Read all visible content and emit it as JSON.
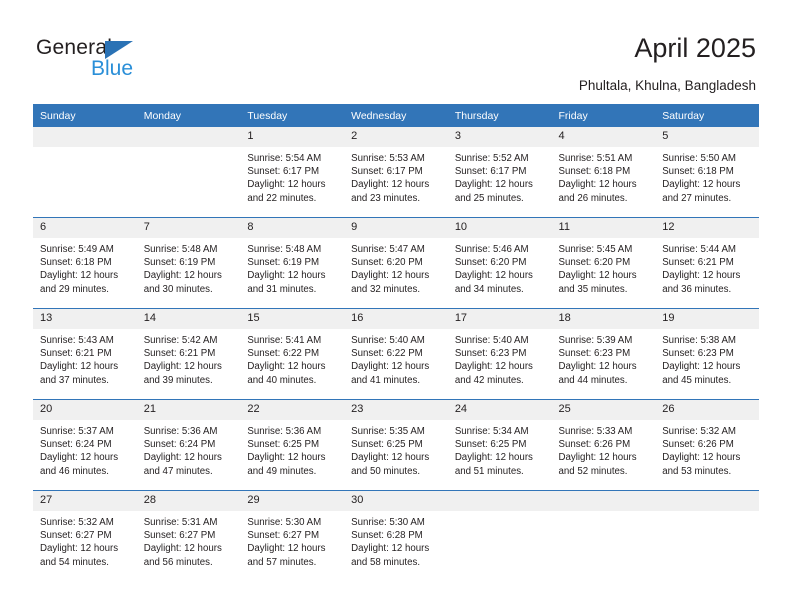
{
  "brand": {
    "name_part1": "General",
    "name_part2": "Blue",
    "flag_color": "#2a72b5",
    "blue_text_color": "#2a8fd8"
  },
  "header": {
    "title": "April 2025",
    "subtitle": "Phultala, Khulna, Bangladesh"
  },
  "calendar": {
    "header_color": "#3275b8",
    "daynum_band_color": "#f0f0f0",
    "weekday_headers": [
      "Sunday",
      "Monday",
      "Tuesday",
      "Wednesday",
      "Thursday",
      "Friday",
      "Saturday"
    ],
    "weeks": [
      [
        {
          "day": "",
          "lines": []
        },
        {
          "day": "",
          "lines": []
        },
        {
          "day": "1",
          "lines": [
            "Sunrise: 5:54 AM",
            "Sunset: 6:17 PM",
            "Daylight: 12 hours",
            "and 22 minutes."
          ]
        },
        {
          "day": "2",
          "lines": [
            "Sunrise: 5:53 AM",
            "Sunset: 6:17 PM",
            "Daylight: 12 hours",
            "and 23 minutes."
          ]
        },
        {
          "day": "3",
          "lines": [
            "Sunrise: 5:52 AM",
            "Sunset: 6:17 PM",
            "Daylight: 12 hours",
            "and 25 minutes."
          ]
        },
        {
          "day": "4",
          "lines": [
            "Sunrise: 5:51 AM",
            "Sunset: 6:18 PM",
            "Daylight: 12 hours",
            "and 26 minutes."
          ]
        },
        {
          "day": "5",
          "lines": [
            "Sunrise: 5:50 AM",
            "Sunset: 6:18 PM",
            "Daylight: 12 hours",
            "and 27 minutes."
          ]
        }
      ],
      [
        {
          "day": "6",
          "lines": [
            "Sunrise: 5:49 AM",
            "Sunset: 6:18 PM",
            "Daylight: 12 hours",
            "and 29 minutes."
          ]
        },
        {
          "day": "7",
          "lines": [
            "Sunrise: 5:48 AM",
            "Sunset: 6:19 PM",
            "Daylight: 12 hours",
            "and 30 minutes."
          ]
        },
        {
          "day": "8",
          "lines": [
            "Sunrise: 5:48 AM",
            "Sunset: 6:19 PM",
            "Daylight: 12 hours",
            "and 31 minutes."
          ]
        },
        {
          "day": "9",
          "lines": [
            "Sunrise: 5:47 AM",
            "Sunset: 6:20 PM",
            "Daylight: 12 hours",
            "and 32 minutes."
          ]
        },
        {
          "day": "10",
          "lines": [
            "Sunrise: 5:46 AM",
            "Sunset: 6:20 PM",
            "Daylight: 12 hours",
            "and 34 minutes."
          ]
        },
        {
          "day": "11",
          "lines": [
            "Sunrise: 5:45 AM",
            "Sunset: 6:20 PM",
            "Daylight: 12 hours",
            "and 35 minutes."
          ]
        },
        {
          "day": "12",
          "lines": [
            "Sunrise: 5:44 AM",
            "Sunset: 6:21 PM",
            "Daylight: 12 hours",
            "and 36 minutes."
          ]
        }
      ],
      [
        {
          "day": "13",
          "lines": [
            "Sunrise: 5:43 AM",
            "Sunset: 6:21 PM",
            "Daylight: 12 hours",
            "and 37 minutes."
          ]
        },
        {
          "day": "14",
          "lines": [
            "Sunrise: 5:42 AM",
            "Sunset: 6:21 PM",
            "Daylight: 12 hours",
            "and 39 minutes."
          ]
        },
        {
          "day": "15",
          "lines": [
            "Sunrise: 5:41 AM",
            "Sunset: 6:22 PM",
            "Daylight: 12 hours",
            "and 40 minutes."
          ]
        },
        {
          "day": "16",
          "lines": [
            "Sunrise: 5:40 AM",
            "Sunset: 6:22 PM",
            "Daylight: 12 hours",
            "and 41 minutes."
          ]
        },
        {
          "day": "17",
          "lines": [
            "Sunrise: 5:40 AM",
            "Sunset: 6:23 PM",
            "Daylight: 12 hours",
            "and 42 minutes."
          ]
        },
        {
          "day": "18",
          "lines": [
            "Sunrise: 5:39 AM",
            "Sunset: 6:23 PM",
            "Daylight: 12 hours",
            "and 44 minutes."
          ]
        },
        {
          "day": "19",
          "lines": [
            "Sunrise: 5:38 AM",
            "Sunset: 6:23 PM",
            "Daylight: 12 hours",
            "and 45 minutes."
          ]
        }
      ],
      [
        {
          "day": "20",
          "lines": [
            "Sunrise: 5:37 AM",
            "Sunset: 6:24 PM",
            "Daylight: 12 hours",
            "and 46 minutes."
          ]
        },
        {
          "day": "21",
          "lines": [
            "Sunrise: 5:36 AM",
            "Sunset: 6:24 PM",
            "Daylight: 12 hours",
            "and 47 minutes."
          ]
        },
        {
          "day": "22",
          "lines": [
            "Sunrise: 5:36 AM",
            "Sunset: 6:25 PM",
            "Daylight: 12 hours",
            "and 49 minutes."
          ]
        },
        {
          "day": "23",
          "lines": [
            "Sunrise: 5:35 AM",
            "Sunset: 6:25 PM",
            "Daylight: 12 hours",
            "and 50 minutes."
          ]
        },
        {
          "day": "24",
          "lines": [
            "Sunrise: 5:34 AM",
            "Sunset: 6:25 PM",
            "Daylight: 12 hours",
            "and 51 minutes."
          ]
        },
        {
          "day": "25",
          "lines": [
            "Sunrise: 5:33 AM",
            "Sunset: 6:26 PM",
            "Daylight: 12 hours",
            "and 52 minutes."
          ]
        },
        {
          "day": "26",
          "lines": [
            "Sunrise: 5:32 AM",
            "Sunset: 6:26 PM",
            "Daylight: 12 hours",
            "and 53 minutes."
          ]
        }
      ],
      [
        {
          "day": "27",
          "lines": [
            "Sunrise: 5:32 AM",
            "Sunset: 6:27 PM",
            "Daylight: 12 hours",
            "and 54 minutes."
          ]
        },
        {
          "day": "28",
          "lines": [
            "Sunrise: 5:31 AM",
            "Sunset: 6:27 PM",
            "Daylight: 12 hours",
            "and 56 minutes."
          ]
        },
        {
          "day": "29",
          "lines": [
            "Sunrise: 5:30 AM",
            "Sunset: 6:27 PM",
            "Daylight: 12 hours",
            "and 57 minutes."
          ]
        },
        {
          "day": "30",
          "lines": [
            "Sunrise: 5:30 AM",
            "Sunset: 6:28 PM",
            "Daylight: 12 hours",
            "and 58 minutes."
          ]
        },
        {
          "day": "",
          "lines": []
        },
        {
          "day": "",
          "lines": []
        },
        {
          "day": "",
          "lines": []
        }
      ]
    ]
  }
}
